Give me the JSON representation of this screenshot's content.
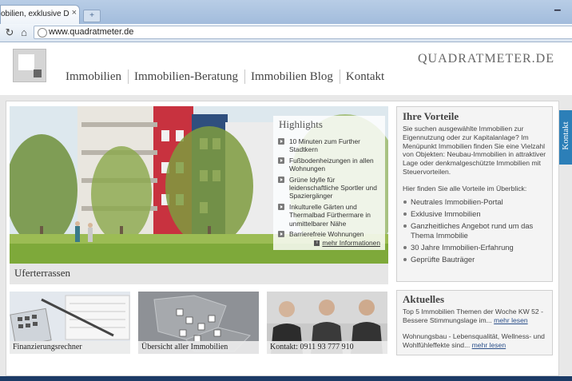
{
  "browser": {
    "tab_title": "obilien, exklusive Denkmal",
    "tab_close": "×",
    "new_tab": "+",
    "url": "www.quadratmeter.de",
    "back_glyph": "C",
    "home_glyph": "⌂"
  },
  "header": {
    "brand": "QUADRATMETER.DE",
    "nav": [
      "Immobilien",
      "Immobilien-Beratung",
      "Immobilien Blog",
      "Kontakt"
    ]
  },
  "hero": {
    "caption": "Uferterrassen",
    "highlights_title": "Highlights",
    "highlights": [
      "10 Minuten zum Further Stadtkern",
      "Fußbodenheizungen in allen Wohnungen",
      "Grüne Idylle für leidenschaftliche Sportler und Spaziergänger",
      "Inkulturelle Gärten und Thermalbad Fürthermare in unmittelbarer Nähe",
      "Barrierefreie Wohnungen"
    ],
    "more_link": "mehr Informationen"
  },
  "vorteile": {
    "title": "Ihre Vorteile",
    "intro": "Sie suchen ausgewählte Immobilien zur Eigennutzung oder zur Kapitalanlage? Im Menüpunkt Immobilien finden Sie eine Vielzahl von Objekten: Neubau-Immobilien in attraktiver Lage oder denkmalgeschützte Immobilien mit Steuervorteilen.",
    "overview": "Hier finden Sie alle Vorteile im Überblick:",
    "items": [
      "Neutrales Immobilien-Portal",
      "Exklusive Immobilien",
      "Ganzheitliches Angebot rund um das Thema Immobilie",
      "30 Jahre Immobilien-Erfahrung",
      "Geprüfte Bauträger"
    ]
  },
  "aktuelles": {
    "title": "Aktuelles",
    "item1_text": "Top 5 Immobilien Themen der Woche KW 52 - Bessere Stimmungslage im...",
    "item1_link": "mehr lesen",
    "item2_text": "Wohnungsbau - Lebensqualität, Wellness- und Wohlfühleffekte sind...",
    "item2_link": "mehr lesen"
  },
  "tiles": [
    {
      "caption": "Finanzierungsrechner"
    },
    {
      "caption": "Übersicht aller Immobilien"
    },
    {
      "caption": "Kontakt: 0911 93 777 910"
    }
  ],
  "side_tab": "Kontakt",
  "colors": {
    "accent_blue": "#2c7fb8",
    "building_red": "#c8323f",
    "building_blue": "#2f4f7e"
  }
}
